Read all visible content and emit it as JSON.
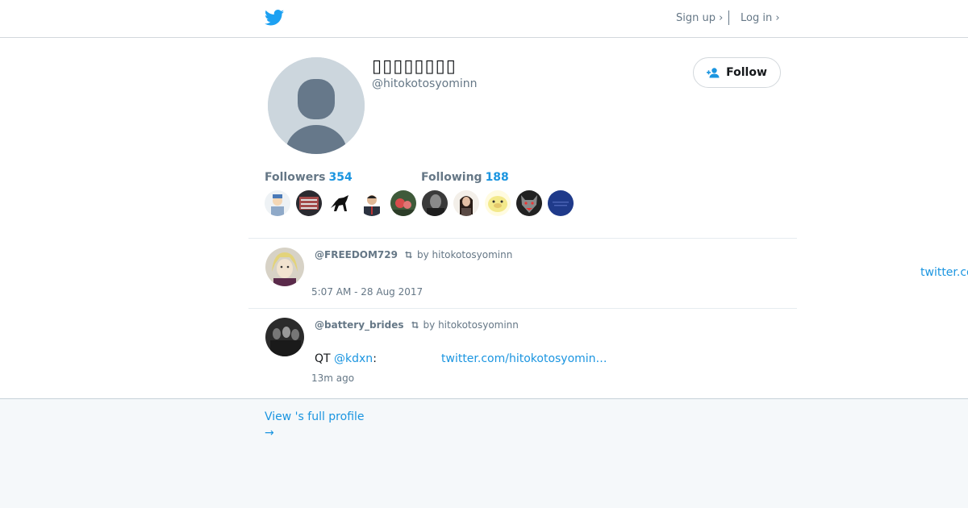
{
  "header": {
    "logo_icon": "twitter-bird-icon",
    "signup_label": "Sign up ›",
    "login_label": "Log in ›"
  },
  "profile": {
    "display_name": "▯▯▯▯▯▯▯▯",
    "handle": "@hitokotosyominn",
    "follow_label": "Follow",
    "followers_label": "Followers",
    "followers_count": "354",
    "following_label": "Following",
    "following_count": "188"
  },
  "tweets": [
    {
      "user": "@FREEDOM729",
      "retweet_by": "by hitokotosyominn",
      "link": "twitter.co",
      "time": "5:07 AM - 28 Aug 2017"
    },
    {
      "user": "@battery_brides",
      "retweet_by": "by hitokotosyominn",
      "text_prefix": "QT",
      "mention": "@kdxn",
      "colon": ":",
      "link": "twitter.com/hitokotosyomin…",
      "time": "13m ago"
    }
  ],
  "footer": {
    "full_profile_label": "View 's full profile",
    "arrow": "→"
  },
  "colors": {
    "accent": "#1b95e0",
    "muted": "#657786",
    "footer_bg": "#f5f8fa"
  }
}
